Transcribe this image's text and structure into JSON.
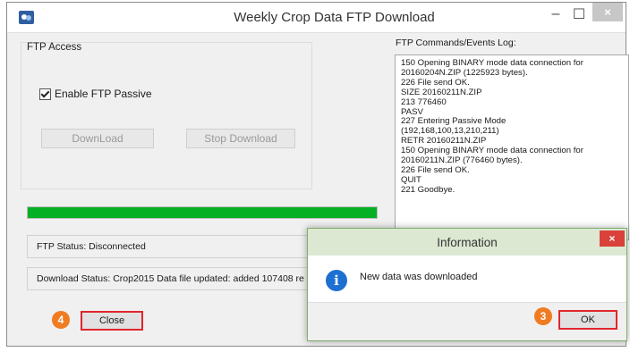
{
  "window": {
    "title": "Weekly Crop Data FTP Download",
    "minimize_glyph": "–",
    "maximize_glyph": "☐",
    "close_glyph": "×"
  },
  "ftp_access": {
    "group_label": "FTP Access",
    "passive_label": "Enable FTP Passive",
    "passive_checked": true,
    "download_label": "DownLoad",
    "stop_label": "Stop Download"
  },
  "progress": {
    "fraction": 1.0,
    "color": "#06b025"
  },
  "status": {
    "ftp_status": "FTP Status:  Disconnected",
    "download_status": "Download Status:  Crop2015 Data file updated: added 107408 re"
  },
  "close_button": {
    "label": "Close",
    "badge": "4"
  },
  "log": {
    "label": "FTP Commands/Events Log:",
    "lines": [
      "150 Opening BINARY mode data connection for",
      "20160204N.ZIP (1225923 bytes).",
      "226 File send OK.",
      "SIZE 20160211N.ZIP",
      "213 776460",
      "PASV",
      "227 Entering Passive Mode",
      "(192,168,100,13,210,211)",
      "RETR 20160211N.ZIP",
      "150 Opening BINARY mode data connection for",
      "20160211N.ZIP (776460 bytes).",
      "226 File send OK.",
      "QUIT",
      "221 Goodbye."
    ]
  },
  "dialog": {
    "title": "Information",
    "close_glyph": "×",
    "info_glyph": "i",
    "message": "New data was downloaded",
    "ok_label": "OK",
    "ok_badge": "3"
  },
  "colors": {
    "highlight_border": "#e0262c",
    "badge": "#f07c22",
    "dialog_title_bg": "#dce8d2"
  }
}
